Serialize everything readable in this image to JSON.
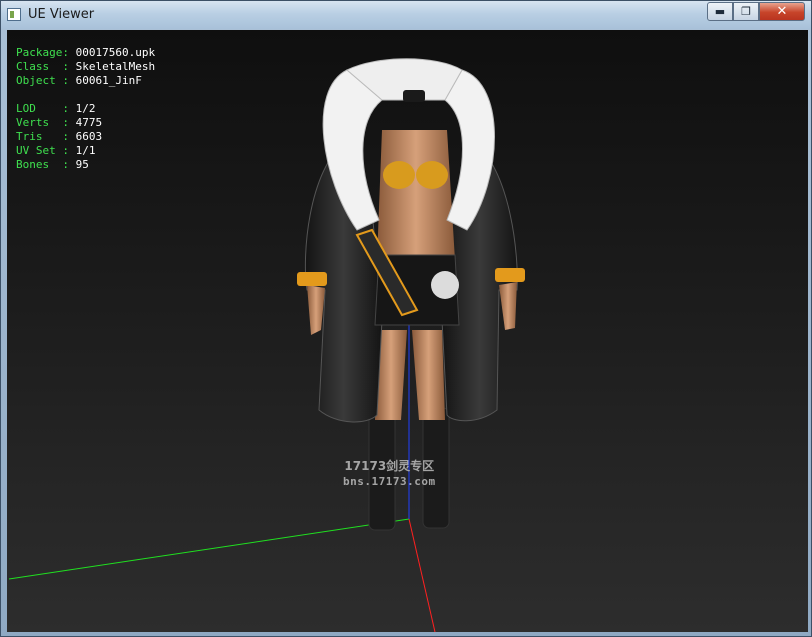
{
  "window": {
    "title": "UE Viewer",
    "close_glyph": "✕",
    "min_glyph": "▬",
    "max_glyph": "❐"
  },
  "info": {
    "package_label": "Package:",
    "package": "00017560.upk",
    "class_label": "Class  :",
    "class": "SkeletalMesh",
    "object_label": "Object :",
    "object": "60061_JinF",
    "lod_label": "LOD    :",
    "lod": "1/2",
    "verts_label": "Verts  :",
    "verts": "4775",
    "tris_label": "Tris   :",
    "tris": "6603",
    "uvset_label": "UV Set :",
    "uvset": "1/1",
    "bones_label": "Bones  :",
    "bones": "95"
  },
  "watermark": {
    "line1": "17173剑灵专区",
    "line2": "bns.17173.com"
  },
  "colors": {
    "label_green": "#3fe04f",
    "axis_x": "#ff2020",
    "axis_y": "#20e020",
    "axis_z": "#2040ff"
  }
}
